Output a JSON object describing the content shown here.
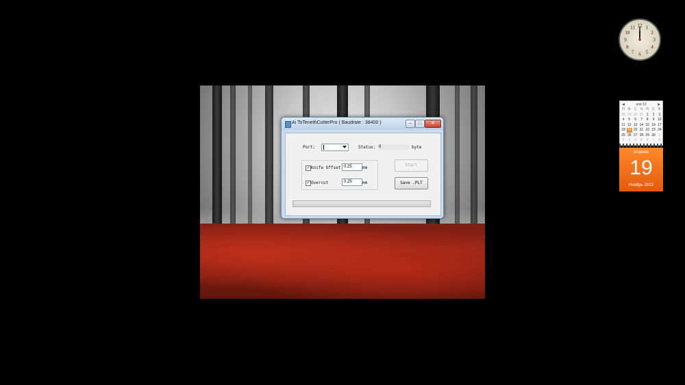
{
  "dialog": {
    "title": "Ai ToTenethCutterPro  ( Baudrate : 38400 )",
    "port_label": "Port:",
    "port_value": "",
    "status_label": "Status:",
    "status_value": "0",
    "status_unit": "byte",
    "knife_offset": {
      "label": "Knife Offset",
      "checked": true,
      "value": "0.25",
      "unit": "mm"
    },
    "overcut": {
      "label": "Overcut",
      "checked": true,
      "value": "0.25",
      "unit": "mm"
    },
    "start_label": "Start",
    "save_label": "Save .PLT",
    "progress": 0,
    "window_buttons": {
      "minimize": "–",
      "maximize": "□",
      "close": "✕"
    }
  },
  "clock": {
    "time_hour": 12,
    "time_minute": 0,
    "numerals": [
      "12",
      "1",
      "2",
      "3",
      "4",
      "5",
      "6",
      "7",
      "8",
      "9",
      "10",
      "11"
    ]
  },
  "calendar": {
    "month_header": "ноя 13",
    "nav_prev": "◀",
    "nav_next": "▶",
    "weekday_heads": [
      "П",
      "В",
      "С",
      "Ч",
      "П",
      "С",
      "В"
    ],
    "days": [
      [
        "28",
        "29",
        "30",
        "31",
        "1",
        "2",
        "3"
      ],
      [
        "4",
        "5",
        "6",
        "7",
        "8",
        "9",
        "10"
      ],
      [
        "11",
        "12",
        "13",
        "14",
        "15",
        "16",
        "17"
      ],
      [
        "18",
        "19",
        "20",
        "21",
        "22",
        "23",
        "24"
      ],
      [
        "25",
        "26",
        "27",
        "28",
        "29",
        "30",
        "1"
      ],
      [
        "2",
        "3",
        "4",
        "5",
        "6",
        "7",
        "8"
      ]
    ],
    "today": "19",
    "weekday": "вторник",
    "day": "19",
    "month_year": "Ноябрь 2013",
    "accent_color": "#f07a20"
  }
}
